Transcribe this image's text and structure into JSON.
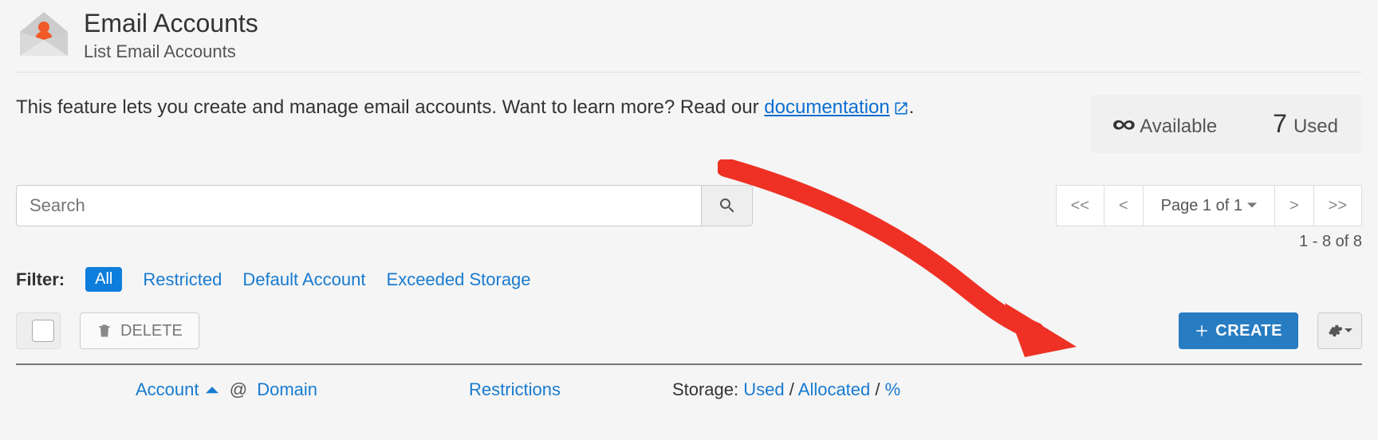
{
  "header": {
    "title": "Email Accounts",
    "subtitle": "List Email Accounts"
  },
  "intro": {
    "text_before_link": "This feature lets you create and manage email accounts. Want to learn more? Read our ",
    "link_text": "documentation",
    "text_after_link": "."
  },
  "stats": {
    "available_label": "Available",
    "available_value": "∞",
    "used_label": "Used",
    "used_value": "7"
  },
  "search": {
    "placeholder": "Search"
  },
  "pagination": {
    "first": "<<",
    "prev": "<",
    "page_label": "Page 1 of 1",
    "next": ">",
    "last": ">>",
    "range": "1 - 8 of 8"
  },
  "filters": {
    "label": "Filter:",
    "all": "All",
    "restricted": "Restricted",
    "default_account": "Default Account",
    "exceeded_storage": "Exceeded Storage"
  },
  "actions": {
    "delete": "DELETE",
    "create": "CREATE"
  },
  "columns": {
    "account": "Account",
    "at": "@",
    "domain": "Domain",
    "restrictions": "Restrictions",
    "storage_label": "Storage:",
    "used": "Used",
    "sep1": "/",
    "allocated": "Allocated",
    "sep2": "/",
    "percent": "%"
  }
}
